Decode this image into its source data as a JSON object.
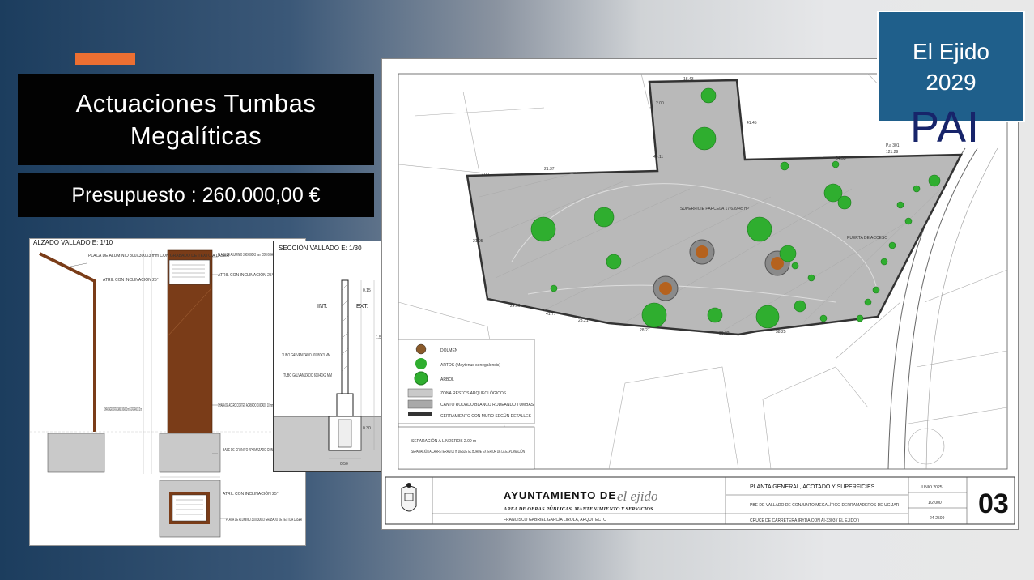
{
  "title": "Actuaciones  Tumbas\nMegalíticas",
  "budget": "Presupuesto : 260.000,00 €",
  "badge": {
    "line1": "El Ejido",
    "line2": "2029",
    "pai": "PAI"
  },
  "elevation": {
    "title": "ALZADO VALLADO  E: 1/10",
    "plaque_note": "PLACA DE ALUMINIO 300X300X3 mm CON GRABADO DE TEXTO A LASER",
    "atril_note": "ATRIL CON INCLINACIÓN 25°",
    "plate_note": "CHAPA DE ACERO CORTÉN ACABADO OXIDADO 10 mm DE ESPESOR ANCHO 20 cm",
    "base_note": "BASE DE GRANITO APOMAZADO CON CANTOS EN CHAFLAN",
    "plaque_note2": "PLACA DE ALUMINIO 300X300X3 GRABADO DE TEXTO A LASER"
  },
  "section": {
    "title": "SECCIÓN  VALLADO E: 1/30",
    "int": "INT.",
    "ext": "EXT.",
    "tube1": "TUBO GALVANIZADO 80X80X3 MM",
    "tube2": "TUBO GALVANIZADO 60X40X2 MM",
    "dim1": "0.15",
    "dim2": "1.50",
    "dim3": "0.30",
    "dim4": "0.50"
  },
  "plan": {
    "area_label": "SUPERFICIE PARCELA 17.639,45 m²",
    "gate_label": "PUERTA DE ACCESO",
    "point_label": "P.a 301",
    "point_value": "121.29",
    "legend": [
      {
        "label": "DOLMEN"
      },
      {
        "label": "ARTOS (Maytenus senegalensis)"
      },
      {
        "label": "ARBOL"
      },
      {
        "label": "ZONA RESTOS ARQUEOLÓGICOS"
      },
      {
        "label": "CANTO RODADO BLANCO RODEANDO TUMBAS"
      },
      {
        "label": "CERRAMIENTO CON MURO SEGÚN DETALLES"
      }
    ],
    "notes": [
      "SEPARACIÓN A LINDEROS 2.00 m",
      "SEPARACIÓN A CARRETERA 9.00 m DESDE EL BORDE EXTERIOR DE LA EXPLANACIÓN"
    ],
    "dims": [
      "18.43",
      "2.00",
      "41.45",
      "21.37",
      "44.11",
      "2.00",
      "34.55",
      "21.95",
      "28.27",
      "36.32",
      "38.25",
      "24.06",
      "41.77",
      "23.21"
    ]
  },
  "title_block": {
    "council": "AYUNTAMIENTO  DE",
    "council_logo": "el ejido",
    "area": "AREA DE OBRAS PÚBLICAS, MANTENIMIENTO Y SERVICIOS",
    "drawing_title": "PLANTA GENERAL, ACOTADO Y SUPERFICIES",
    "project": "PBE DE VALLADO DE CONJUNTO MEGALÍTICO DERRAMADEROS DE UGÍJAR",
    "location": "CRUCE DE CARRETERA IRYDA CON AI-3303 ( EL EJIDO )",
    "author": "FRANCISCO GABRIEL GARCÍA LIROLA,      ARQUITECTO",
    "date": "JUNIO 2025",
    "scale": "1/2.000",
    "reference": "24-2509",
    "sheet": "03"
  },
  "colors": {
    "accent": "#ec6f32",
    "badge": "#1f5f8b",
    "pai_text": "#17246a",
    "corten": "#7a3c18",
    "tree": "#2fae2f",
    "parcel": "#b9b9b9"
  }
}
